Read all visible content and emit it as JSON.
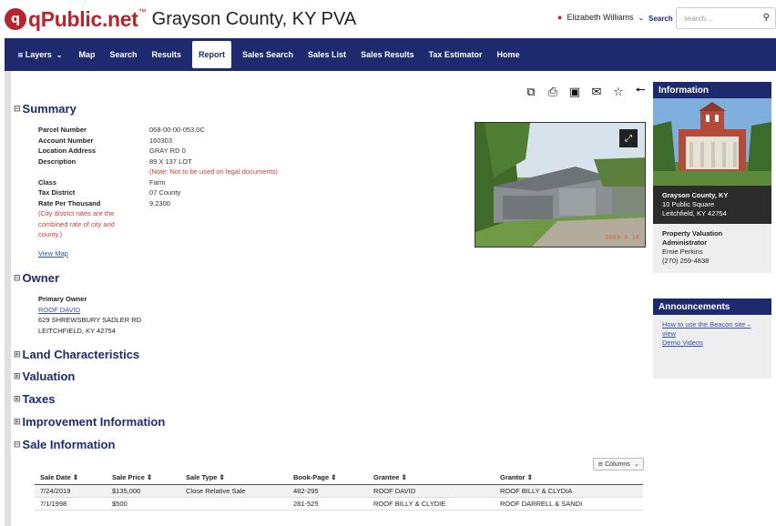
{
  "header": {
    "logo_letter": "q",
    "logo_text": "qPublic.net",
    "logo_tm": "™",
    "site_title": "Grayson County, KY PVA",
    "user_name": "Elizabeth Williams",
    "search_label": "Search",
    "search_placeholder": "search..."
  },
  "nav": {
    "items": [
      {
        "label": "Layers"
      },
      {
        "label": "Map"
      },
      {
        "label": "Search"
      },
      {
        "label": "Results"
      },
      {
        "label": "Report"
      },
      {
        "label": "Sales Search"
      },
      {
        "label": "Sales List"
      },
      {
        "label": "Sales Results"
      },
      {
        "label": "Tax Estimator"
      },
      {
        "label": "Home"
      }
    ]
  },
  "summary": {
    "title": "Summary",
    "parcel_number_label": "Parcel Number",
    "parcel_number": "068-00-00-053.0C",
    "account_number_label": "Account Number",
    "account_number": "160303",
    "location_label": "Location Address",
    "location": "GRAY RD 0",
    "description_label": "Description",
    "description": "89 X 137 LOT",
    "description_note": "(Note: Not to be used on legal documents)",
    "class_label": "Class",
    "class": "Farm",
    "tax_district_label": "Tax District",
    "tax_district": "07 County",
    "rate_label": "Rate Per Thousand",
    "rate": "9.2300",
    "rate_note_1": "(City district rates are the",
    "rate_note_2": "combined rate of city and",
    "rate_note_3": "county.)",
    "view_map": "View Map",
    "photo_stamp": "2009  9 14"
  },
  "owner": {
    "title": "Owner",
    "primary_label": "Primary Owner",
    "name": "ROOF DAVID",
    "address_1": "629 SHREWSBURY SADLER RD",
    "address_2": "LEITCHFIELD, KY 42754"
  },
  "sections": {
    "land": "Land Characteristics",
    "valuation": "Valuation",
    "taxes": "Taxes",
    "improvement": "Improvement Information",
    "sale": "Sale Information"
  },
  "sale_table": {
    "columns_button": "Columns",
    "headers": [
      "Sale Date",
      "Sale Price",
      "Sale Type",
      "Book-Page",
      "Grantee",
      "Grantor"
    ],
    "rows": [
      [
        "7/24/2019",
        "$135,000",
        "Close Relative Sale",
        "482-295",
        "ROOF DAVID",
        "ROOF BILLY & CLYDIA"
      ],
      [
        "7/1/1998",
        "$500",
        "",
        "281-525",
        "ROOF BILLY & CLYDIE",
        "ROOF DARRELL & SANDI"
      ]
    ]
  },
  "sidebar": {
    "info_title": "Information",
    "county": "Grayson County, KY",
    "address_1": "10 Public Square",
    "address_2": "Leitchfield, KY 42754",
    "pva_title_1": "Property Valuation",
    "pva_title_2": "Administrator",
    "pva_name": "Ernie Perkins",
    "pva_phone": "(270) 259-4838",
    "announcements_title": "Announcements",
    "announcement_link_1": "How to use the Beacon site – view",
    "announcement_link_2": "Demo Videos"
  }
}
